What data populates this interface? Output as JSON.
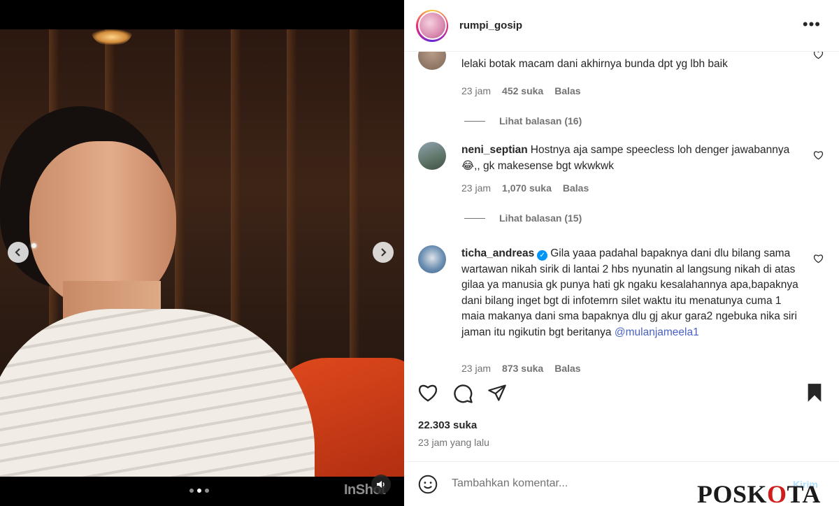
{
  "media": {
    "watermark": "InShot",
    "carousel": {
      "count": 3,
      "active_index": 1
    }
  },
  "post": {
    "username": "rumpi_gosip",
    "likes": "22.303 suka",
    "time": "23 jam yang lalu"
  },
  "comments": [
    {
      "username": "",
      "text": "lelaki botak macam dani akhirnya bunda dpt yg lbh baik",
      "time": "23 jam",
      "likes": "452 suka",
      "reply": "Balas",
      "view_replies": "Lihat balasan (16)"
    },
    {
      "username": "neni_septian",
      "text": "Hostnya aja sampe speecless loh denger jawabannya😂,, gk makesense bgt wkwkwk",
      "time": "23 jam",
      "likes": "1,070 suka",
      "reply": "Balas",
      "view_replies": "Lihat balasan (15)"
    },
    {
      "username": "ticha_andreas",
      "verified": true,
      "text": "Gila yaaa padahal bapaknya dani dlu bilang sama wartawan nikah sirik di lantai 2 hbs nyunatin al langsung nikah di atas gilaa ya manusia gk punya hati gk ngaku kesalahannya apa,bapaknya dani bilang inget bgt di infotemrn silet waktu itu menatunya cuma 1 maia makanya dani sma bapaknya dlu gj akur gara2 ngebuka nika siri jaman itu ngikutin bgt beritanya",
      "mention": "@mulanjameela1",
      "time": "23 jam",
      "likes": "873 suka",
      "reply": "Balas"
    }
  ],
  "composer": {
    "placeholder": "Tambahkan komentar...",
    "post_label": "Kirim"
  },
  "icons": {
    "prev": "chevron-left-icon",
    "next": "chevron-right-icon",
    "sound": "speaker-icon",
    "more": "more-horizontal-icon",
    "like": "heart-icon",
    "comment": "comment-icon",
    "share": "send-icon",
    "save": "bookmark-icon",
    "emoji": "emoji-icon"
  },
  "watermark_site": {
    "left": "POSK",
    "mid": "O",
    "right": "TA"
  },
  "colors": {
    "verified": "#0095f6",
    "mention": "#4a61c7",
    "post_button": "#b2dffc"
  }
}
